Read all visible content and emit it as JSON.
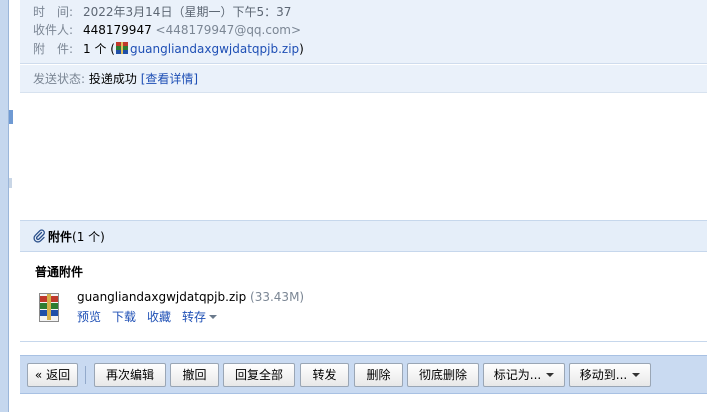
{
  "header": {
    "time_label": "时　间:",
    "time_value": "2022年3月14日（星期一）下午5：37",
    "to_label": "收件人:",
    "to_name": "448179947",
    "to_email": "<448179947@qq.com>",
    "att_label": "附　件:",
    "att_count": "1 个 (",
    "att_file": "guangliandaxgwjdatqpjb.zip",
    "att_close": ")"
  },
  "status": {
    "label": "发送状态:",
    "value": "投递成功",
    "link": "[查看详情]"
  },
  "attachments": {
    "title": "附件",
    "count": "(1 个)",
    "section": "普通附件",
    "file": {
      "name": "guangliandaxgwjdatqpjb.zip",
      "size": "(33.43M)",
      "actions": [
        "预览",
        "下载",
        "收藏"
      ],
      "more": "转存"
    }
  },
  "toolbar": {
    "back": "« 返回",
    "edit_again": "再次编辑",
    "recall": "撤回",
    "reply_all": "回复全部",
    "forward": "转发",
    "delete": "删除",
    "delete_forever": "彻底删除",
    "mark_as": "标记为...",
    "move_to": "移动到..."
  },
  "colors": {
    "link": "#1e4fb5",
    "header_bg": "#eaf1fa",
    "toolbar_bg": "#c9daf1"
  }
}
